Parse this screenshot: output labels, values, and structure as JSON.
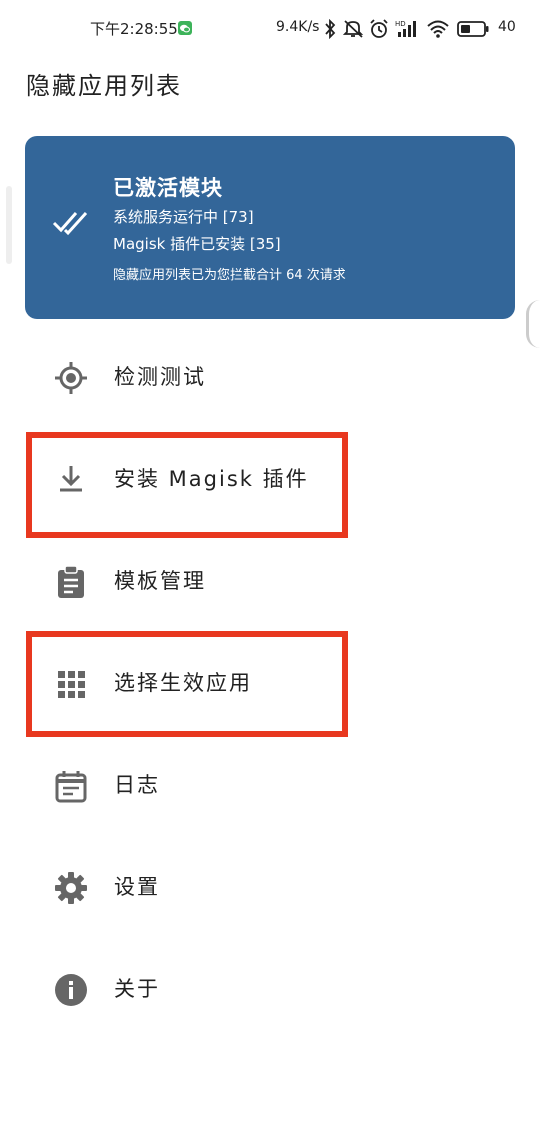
{
  "status_bar": {
    "time": "下午2:28:55",
    "net_speed": "9.4K/s",
    "battery": "40",
    "icons": [
      "wechat-notification-icon",
      "bluetooth-icon",
      "mute-icon",
      "alarm-icon",
      "hd-signal-icon",
      "wifi-icon",
      "battery-icon"
    ]
  },
  "header": {
    "title": "隐藏应用列表"
  },
  "status_card": {
    "title": "已激活模块",
    "line1": "系统服务运行中 [73]",
    "line2": "Magisk 插件已安装 [35]",
    "line3": "隐藏应用列表已为您拦截合计 64 次请求",
    "icon": "double-check-icon",
    "color": "#336699"
  },
  "menu": {
    "items": [
      {
        "label": "检测测试",
        "icon": "target-icon"
      },
      {
        "label": "安装 Magisk 插件",
        "icon": "download-icon"
      },
      {
        "label": "模板管理",
        "icon": "clipboard-icon"
      },
      {
        "label": "选择生效应用",
        "icon": "grid-icon"
      },
      {
        "label": "日志",
        "icon": "calendar-log-icon"
      },
      {
        "label": "设置",
        "icon": "gear-icon"
      },
      {
        "label": "关于",
        "icon": "info-icon"
      }
    ]
  },
  "annotations": {
    "highlight_color": "#e8381f"
  }
}
